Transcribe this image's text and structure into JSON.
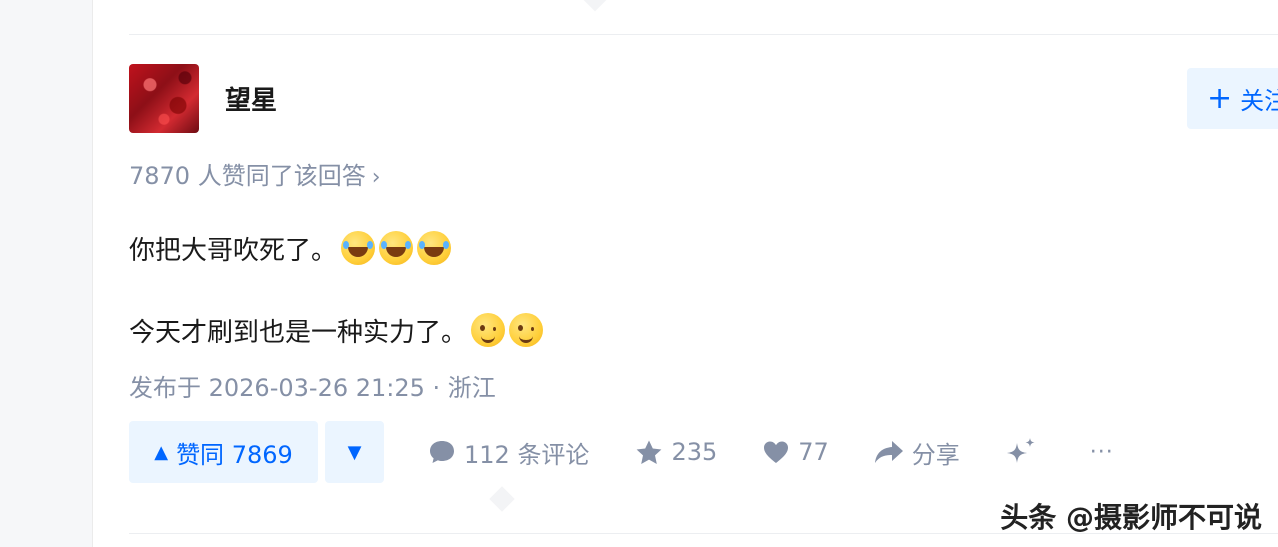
{
  "author": {
    "name": "望星",
    "follow_label": "关注"
  },
  "answer": {
    "votes_summary": "7870 人赞同了该回答",
    "line1": "你把大哥吹死了。",
    "line2": "今天才刷到也是一种实力了。",
    "published": "发布于 2026-03-26 21:25 · 浙江"
  },
  "actions": {
    "upvote_label": "赞同 7869",
    "comments": "112 条评论",
    "favorites": "235",
    "likes": "77",
    "share": "分享",
    "more": "···"
  },
  "watermark": "头条 @摄影师不可说",
  "colors": {
    "accent": "#0066ff",
    "accent_bg": "#ebf5ff",
    "meta_gray": "#8590a6"
  },
  "icons": [
    "plus-icon",
    "chevron-right-icon",
    "laugh-emoji-icon",
    "wink-emoji-icon",
    "triangle-up-icon",
    "triangle-down-icon",
    "comment-bubble-icon",
    "star-icon",
    "heart-icon",
    "share-arrow-icon",
    "sparkle-icon",
    "ellipsis-icon"
  ]
}
